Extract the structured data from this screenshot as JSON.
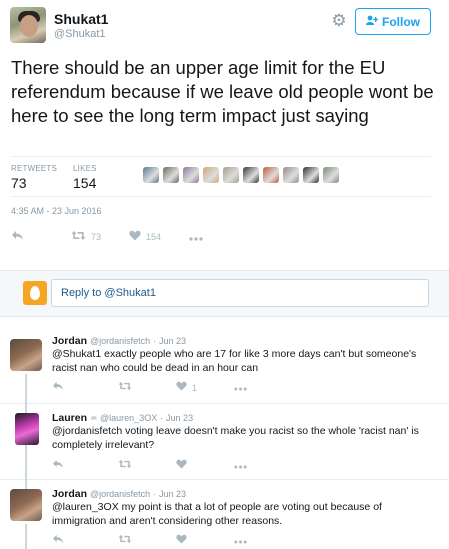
{
  "tweet": {
    "author_name": "Shukat1",
    "author_handle": "@Shukat1",
    "follow_label": "Follow",
    "text": "There should be an upper age limit for the EU referendum because if we leave old people wont be here to see the long term impact just saying",
    "retweets_label": "RETWEETS",
    "retweets_value": "73",
    "likes_label": "LIKES",
    "likes_value": "154",
    "timestamp": "4:35 AM - 23 Jun 2016",
    "action_retweet_count": "73",
    "action_like_count": "154",
    "liker_colors": [
      "#5a7a8c",
      "#6d6a58",
      "#8a7a9a",
      "#d0a676",
      "#a89c8c",
      "#3d3440",
      "#c85a3c",
      "#9a8a8a",
      "#2f2f35",
      "#7d8a7a"
    ]
  },
  "reply_box": {
    "placeholder_prefix": "Reply to ",
    "mention": "@Shukat1"
  },
  "replies": [
    {
      "name": "Jordan",
      "handle": "@jordanisfetch",
      "date": "Jun 23",
      "text": "@Shukat1 exactly people who are 17 for like 3 more days can't but someone's racist nan who could be dead in an hour can",
      "like_count": "1"
    },
    {
      "name": "Lauren",
      "badge": "♒",
      "handle": "@lauren_3OX",
      "date": "Jun 23",
      "text": "@jordanisfetch voting leave doesn't make you racist so the whole 'racist nan' is completely irrelevant?",
      "like_count": ""
    },
    {
      "name": "Jordan",
      "handle": "@jordanisfetch",
      "date": "Jun 23",
      "text": "@lauren_3OX my point is that a lot of people are voting out because of immigration and aren't considering other reasons.",
      "like_count": ""
    }
  ],
  "icons": {
    "gear": "gear-icon",
    "follow": "add-user-icon",
    "reply": "reply-icon",
    "retweet": "retweet-icon",
    "like": "heart-icon",
    "more": "more-icon"
  },
  "colors": {
    "accent": "#1da1f2",
    "muted": "#8899a6",
    "icon": "#aab8c2",
    "reply_egg": "#f5a623"
  }
}
